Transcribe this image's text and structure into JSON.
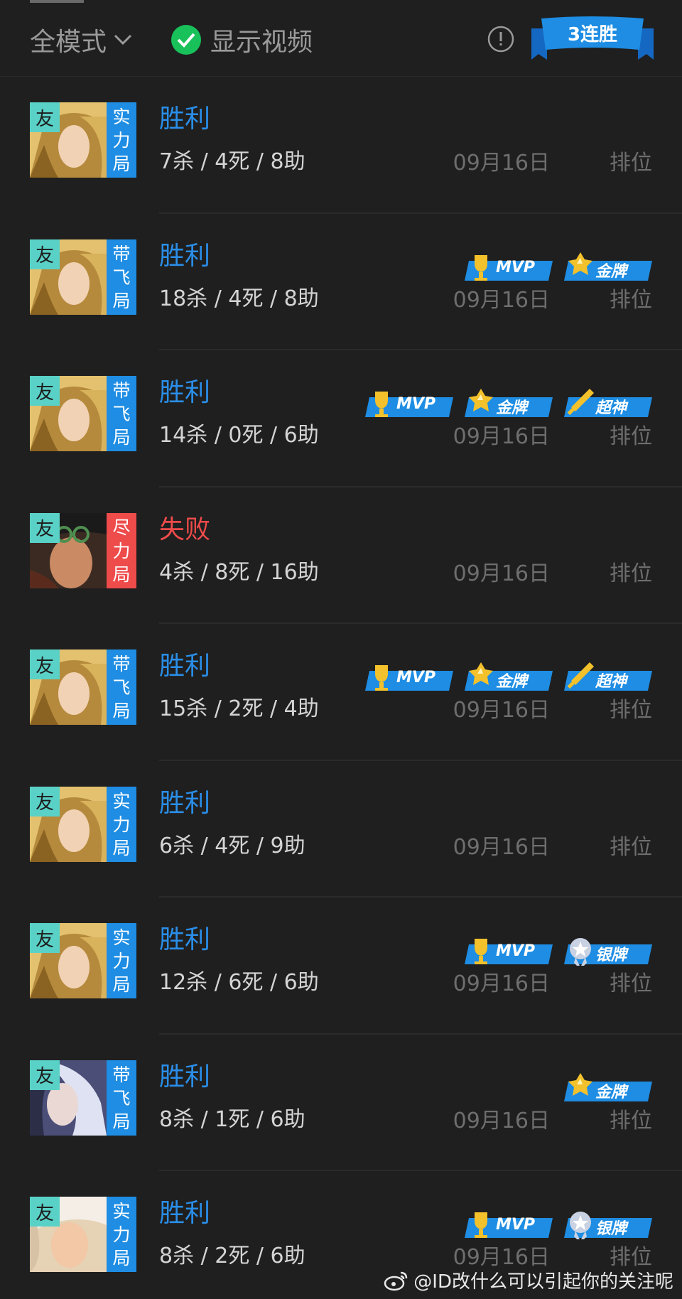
{
  "header": {
    "mode": "全模式",
    "show_video": "显示视频",
    "streak": "3连胜"
  },
  "colors": {
    "win": "#2a8ee8",
    "loss": "#ee4b4b",
    "friend": "#5ad1c7",
    "check": "#18c15a"
  },
  "matches": [
    {
      "friend": "友",
      "role": [
        "实",
        "力",
        "局"
      ],
      "result": "胜利",
      "kda": "7杀 / 4死 / 8助",
      "date": "09月16日",
      "type": "排位",
      "badges": []
    },
    {
      "friend": "友",
      "role": [
        "带",
        "飞",
        "局"
      ],
      "result": "胜利",
      "kda": "18杀 / 4死 / 8助",
      "date": "09月16日",
      "type": "排位",
      "badges": [
        "MVP",
        "金牌"
      ]
    },
    {
      "friend": "友",
      "role": [
        "带",
        "飞",
        "局"
      ],
      "result": "胜利",
      "kda": "14杀 / 0死 / 6助",
      "date": "09月16日",
      "type": "排位",
      "badges": [
        "MVP",
        "金牌",
        "超神"
      ]
    },
    {
      "friend": "友",
      "role": [
        "尽",
        "力",
        "局"
      ],
      "result": "失败",
      "kda": "4杀 / 8死 / 16助",
      "date": "09月16日",
      "type": "排位",
      "badges": []
    },
    {
      "friend": "友",
      "role": [
        "带",
        "飞",
        "局"
      ],
      "result": "胜利",
      "kda": "15杀 / 2死 / 4助",
      "date": "09月16日",
      "type": "排位",
      "badges": [
        "MVP",
        "金牌",
        "超神"
      ]
    },
    {
      "friend": "友",
      "role": [
        "实",
        "力",
        "局"
      ],
      "result": "胜利",
      "kda": "6杀 / 4死 / 9助",
      "date": "09月16日",
      "type": "排位",
      "badges": []
    },
    {
      "friend": "友",
      "role": [
        "实",
        "力",
        "局"
      ],
      "result": "胜利",
      "kda": "12杀 / 6死 / 6助",
      "date": "09月16日",
      "type": "排位",
      "badges": [
        "MVP",
        "银牌"
      ]
    },
    {
      "friend": "友",
      "role": [
        "带",
        "飞",
        "局"
      ],
      "result": "胜利",
      "kda": "8杀 / 1死 / 6助",
      "date": "09月16日",
      "type": "排位",
      "badges": [
        "金牌"
      ]
    },
    {
      "friend": "友",
      "role": [
        "实",
        "力",
        "局"
      ],
      "result": "胜利",
      "kda": "8杀 / 2死 / 6助",
      "date": "09月16日",
      "type": "排位",
      "badges": [
        "MVP",
        "银牌"
      ]
    }
  ],
  "watermark": "@ID改什么可以引起你的关注呢"
}
